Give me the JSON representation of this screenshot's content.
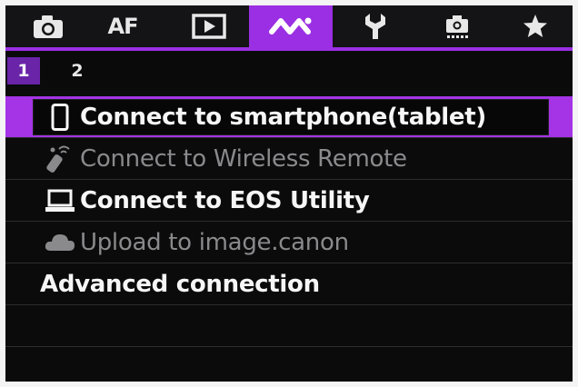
{
  "tabs": [
    {
      "name": "camera-icon",
      "label": ""
    },
    {
      "name": "af",
      "label": "AF"
    },
    {
      "name": "playback-icon",
      "label": ""
    },
    {
      "name": "wireless-icon",
      "label": ""
    },
    {
      "name": "wrench-icon",
      "label": ""
    },
    {
      "name": "custom-function-icon",
      "label": ""
    },
    {
      "name": "star-icon",
      "label": ""
    }
  ],
  "active_tab": "wireless-icon",
  "pages": [
    "1",
    "2"
  ],
  "active_page": "1",
  "menu": {
    "items": [
      {
        "label": "Connect to smartphone(tablet)",
        "icon": "smartphone-icon",
        "enabled": true,
        "selected": true
      },
      {
        "label": "Connect to Wireless Remote",
        "icon": "remote-control-icon",
        "enabled": false,
        "selected": false
      },
      {
        "label": "Connect to EOS Utility",
        "icon": "laptop-icon",
        "enabled": true,
        "selected": false
      },
      {
        "label": "Upload to image.canon",
        "icon": "cloud-icon",
        "enabled": false,
        "selected": false
      },
      {
        "label": "Advanced connection",
        "icon": "",
        "enabled": true,
        "selected": false
      }
    ]
  },
  "colors": {
    "accent": "#9b2fe3",
    "text": "#f6f6f6",
    "disabled_text": "#8a8a8c",
    "background": "#0b0b0c"
  }
}
